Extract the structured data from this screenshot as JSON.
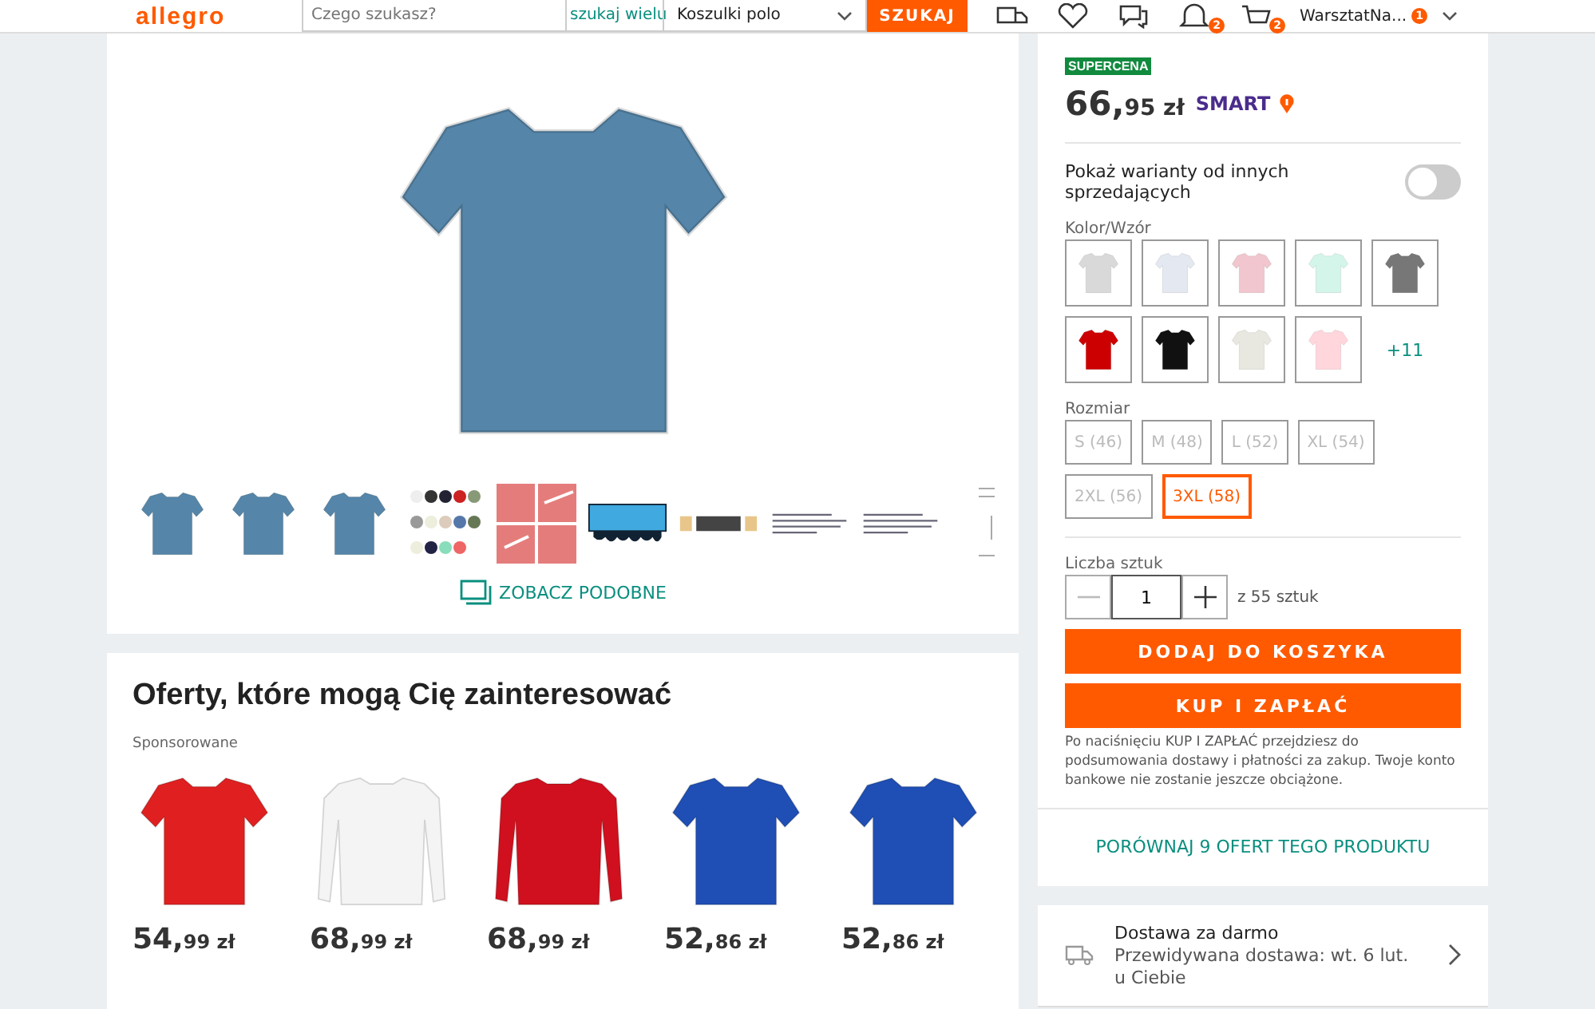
{
  "header": {
    "logo": "allegro",
    "search": {
      "placeholder": "Czego szukasz?"
    },
    "multi_search": "szukaj wielu",
    "category": "Koszulki polo",
    "search_button": "SZUKAJ",
    "notifications_badge": "2",
    "cart_badge": "2",
    "user": "WarsztatNa...",
    "user_badge": "1"
  },
  "gallery": {
    "thumbnails": [
      {
        "kind": "shirt",
        "selected": false
      },
      {
        "kind": "shirt",
        "selected": false
      },
      {
        "kind": "shirt",
        "selected": false
      },
      {
        "kind": "palette",
        "selected": false
      },
      {
        "kind": "detail",
        "selected": false
      },
      {
        "kind": "logo",
        "selected": false
      },
      {
        "kind": "banner",
        "selected": false
      },
      {
        "kind": "text",
        "selected": false
      },
      {
        "kind": "text",
        "selected": false
      },
      {
        "kind": "chart",
        "selected": false
      }
    ],
    "similar": "ZOBACZ PODOBNE"
  },
  "offers": {
    "title": "Oferty, które mogą Cię zainteresować",
    "sponsored": "Sponsorowane",
    "items": [
      {
        "color": "#e02020",
        "kind": "short",
        "price_main": "54,",
        "price_rest": "99 zł"
      },
      {
        "color": "#f4f4f4",
        "kind": "long",
        "price_main": "68,",
        "price_rest": "99 zł"
      },
      {
        "color": "#d0101e",
        "kind": "long",
        "price_main": "68,",
        "price_rest": "99 zł"
      },
      {
        "color": "#1f4fb5",
        "kind": "short",
        "price_main": "52,",
        "price_rest": "86 zł"
      },
      {
        "color": "#1f4fb5",
        "kind": "short",
        "price_main": "52,",
        "price_rest": "86 zł"
      }
    ]
  },
  "buy_box": {
    "badge": "SUPERCENA",
    "price_main": "66,",
    "price_rest": "95 zł",
    "smart": "SMART",
    "variants_toggle": {
      "label": "Pokaż warianty od innych sprzedających",
      "on": false
    },
    "color_label": "Kolor/Wzór",
    "colors": [
      {
        "color": "#d9d9d9",
        "selected": false
      },
      {
        "color": "#e4e8f0",
        "selected": false
      },
      {
        "color": "#f1c6ce",
        "selected": false
      },
      {
        "color": "#d4f5ea",
        "selected": false
      },
      {
        "color": "#777777",
        "selected": false
      },
      {
        "color": "#cc0000",
        "selected": false
      },
      {
        "color": "#111111",
        "selected": false
      },
      {
        "color": "#e8e8e0",
        "selected": false
      },
      {
        "color": "#ffd6dc",
        "selected": false
      }
    ],
    "more_colors": "+11",
    "size_label": "Rozmiar",
    "sizes": [
      {
        "label": "S (46)",
        "selected": false,
        "disabled": true
      },
      {
        "label": "M (48)",
        "selected": false,
        "disabled": true
      },
      {
        "label": "L (52)",
        "selected": false,
        "disabled": true
      },
      {
        "label": "XL (54)",
        "selected": false,
        "disabled": true
      },
      {
        "label": "2XL (56)",
        "selected": false,
        "disabled": true
      },
      {
        "label": "3XL (58)",
        "selected": true,
        "disabled": false
      }
    ],
    "quantity_label": "Liczba sztuk",
    "quantity": "1",
    "stock": "z 55 sztuk",
    "add_to_cart": "DODAJ DO KOSZYKA",
    "buy_now": "KUP I ZAPŁAĆ",
    "note": "Po naciśnięciu KUP I ZAPŁAĆ przejdziesz do podsumowania dostawy i płatności za zakup. Twoje konto bankowe nie zostanie jeszcze obciążone."
  },
  "compare": "PORÓWNAJ 9 OFERT TEGO PRODUKTU",
  "delivery": {
    "title": "Dostawa za darmo",
    "line1": "Przewidywana dostawa: wt. 6 lut.",
    "line2": "u Ciebie"
  }
}
